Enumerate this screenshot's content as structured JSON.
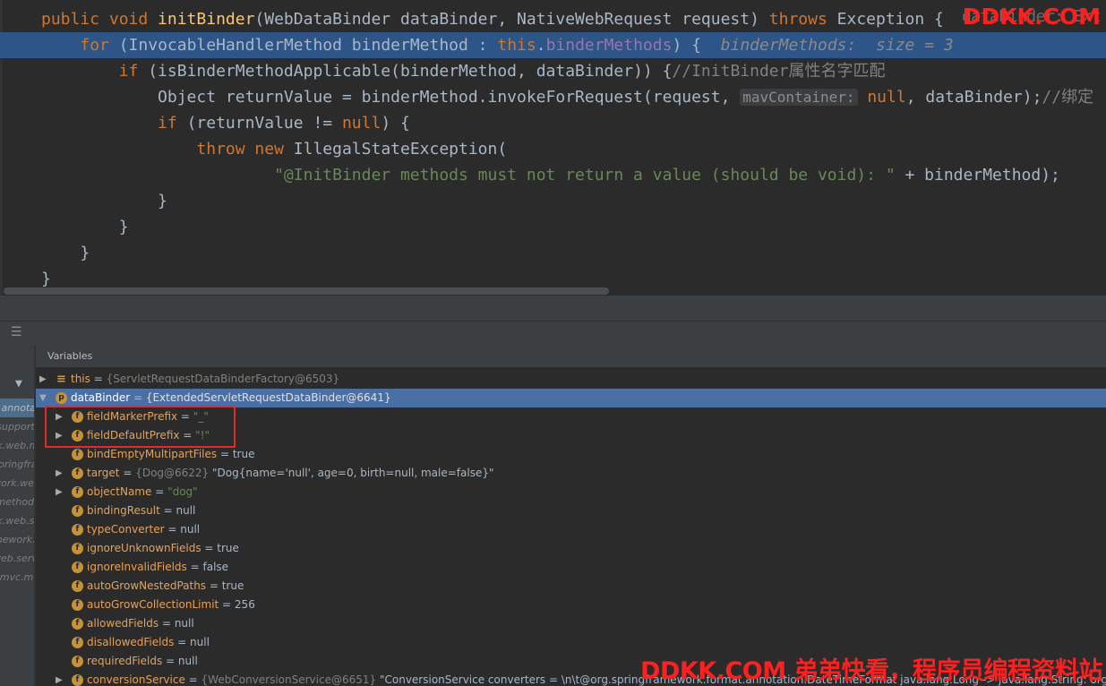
{
  "editor": {
    "lines": [
      {
        "segments": [
          {
            "t": "public ",
            "c": "kw"
          },
          {
            "t": "void ",
            "c": "kw"
          },
          {
            "t": "initBinder",
            "c": "fn"
          },
          {
            "t": "(WebDataBinder dataBinder, NativeWebRequest request) ",
            "c": "pl"
          },
          {
            "t": "throws ",
            "c": "kw"
          },
          {
            "t": "Exception { ",
            "c": "pl"
          }
        ]
      },
      {
        "segments": [
          {
            "t": "    ",
            "c": "pl"
          },
          {
            "t": "for ",
            "c": "kw"
          },
          {
            "t": "(InvocableHandlerMethod binderMethod : ",
            "c": "pl"
          },
          {
            "t": "this",
            "c": "kw"
          },
          {
            "t": ".",
            "c": "pl"
          },
          {
            "t": "binderMethods",
            "c": "fld"
          },
          {
            "t": ") {  ",
            "c": "pl"
          },
          {
            "t": "binderMethods:  size = 3",
            "c": "inl"
          }
        ]
      },
      {
        "segments": [
          {
            "t": "        ",
            "c": "pl"
          },
          {
            "t": "if ",
            "c": "kw"
          },
          {
            "t": "(isBinderMethodApplicable(binderMethod, dataBinder)) {",
            "c": "pl"
          },
          {
            "t": "//InitBinder属性名字匹配",
            "c": "cm"
          }
        ]
      },
      {
        "segments": [
          {
            "t": "            Object returnValue = binderMethod.invokeForRequest(request, ",
            "c": "pl"
          },
          {
            "t": "mavContainer:",
            "c": "hint"
          },
          {
            "t": " ",
            "c": "pl"
          },
          {
            "t": "null",
            "c": "kw"
          },
          {
            "t": ", dataBinder);",
            "c": "pl"
          },
          {
            "t": "//绑定",
            "c": "cm"
          }
        ]
      },
      {
        "segments": [
          {
            "t": "            ",
            "c": "pl"
          },
          {
            "t": "if ",
            "c": "kw"
          },
          {
            "t": "(returnValue != ",
            "c": "pl"
          },
          {
            "t": "null",
            "c": "kw"
          },
          {
            "t": ") {",
            "c": "pl"
          }
        ]
      },
      {
        "segments": [
          {
            "t": "                ",
            "c": "pl"
          },
          {
            "t": "throw ",
            "c": "kw"
          },
          {
            "t": "new ",
            "c": "kw"
          },
          {
            "t": "IllegalStateException(",
            "c": "pl"
          }
        ]
      },
      {
        "segments": [
          {
            "t": "                        ",
            "c": "pl"
          },
          {
            "t": "\"@InitBinder methods must not return a value (should be void): \"",
            "c": "str"
          },
          {
            "t": " + binderMethod);",
            "c": "pl"
          }
        ]
      },
      {
        "segments": [
          {
            "t": "            }",
            "c": "pl"
          }
        ]
      },
      {
        "segments": [
          {
            "t": "        }",
            "c": "pl"
          }
        ]
      },
      {
        "segments": [
          {
            "t": "    }",
            "c": "pl"
          }
        ]
      },
      {
        "segments": [
          {
            "t": "}",
            "c": "pl"
          }
        ]
      }
    ],
    "watermark": "DDKK.COM",
    "watermark_ghost": "dataBinder: Ext"
  },
  "debugger": {
    "layout_icon": "☰",
    "filter_icon": "▼",
    "frames": [
      {
        "label": "c.annota",
        "selected": true
      },
      {
        "label": "(support)",
        "selected": false
      },
      {
        "label": "rk.web.m",
        "selected": false
      },
      {
        "label": "springframe",
        "selected": false
      },
      {
        "label": "work.we",
        "selected": false
      },
      {
        "label": ".method",
        "selected": false
      },
      {
        "label": "rk.web.se",
        "selected": false
      },
      {
        "label": "mework.",
        "selected": false
      },
      {
        "label": "web.serv",
        "selected": false
      },
      {
        "label": "t.mvc.m",
        "selected": false
      }
    ],
    "variables_tab": "Variables",
    "variables": [
      {
        "expand": "collapsed",
        "indent": 0,
        "badge": "list",
        "badge_text": "≡",
        "name": "this",
        "sep": " = ",
        "type": "{ServletRequestDataBinderFactory@6503}",
        "value": "",
        "str": ""
      },
      {
        "expand": "expanded",
        "indent": 0,
        "badge": "p",
        "badge_text": "p",
        "name": "dataBinder",
        "sep": " = ",
        "type": "{ExtendedServletRequestDataBinder@6641}",
        "value": "",
        "str": "",
        "selected": true
      },
      {
        "expand": "collapsed",
        "indent": 1,
        "badge": "f",
        "badge_text": "f",
        "name": "fieldMarkerPrefix",
        "sep": " = ",
        "type": "",
        "value": "",
        "str": "\"_\""
      },
      {
        "expand": "collapsed",
        "indent": 1,
        "badge": "f",
        "badge_text": "f",
        "name": "fieldDefaultPrefix",
        "sep": " = ",
        "type": "",
        "value": "",
        "str": "\"!\""
      },
      {
        "expand": "none",
        "indent": 1,
        "badge": "f",
        "badge_text": "f",
        "name": "bindEmptyMultipartFiles",
        "sep": " = ",
        "type": "",
        "value": "true",
        "str": ""
      },
      {
        "expand": "collapsed",
        "indent": 1,
        "badge": "f",
        "badge_text": "f",
        "name": "target",
        "sep": " = ",
        "type": "{Dog@6622}",
        "value": " \"Dog{name='null', age=0, birth=null, male=false}\"",
        "str": ""
      },
      {
        "expand": "collapsed",
        "indent": 1,
        "badge": "f",
        "badge_text": "f",
        "name": "objectName",
        "sep": " = ",
        "type": "",
        "value": "",
        "str": "\"dog\""
      },
      {
        "expand": "none",
        "indent": 1,
        "badge": "f",
        "badge_text": "f",
        "name": "bindingResult",
        "sep": " = ",
        "type": "",
        "value": "null",
        "str": ""
      },
      {
        "expand": "none",
        "indent": 1,
        "badge": "f",
        "badge_text": "f",
        "name": "typeConverter",
        "sep": " = ",
        "type": "",
        "value": "null",
        "str": ""
      },
      {
        "expand": "none",
        "indent": 1,
        "badge": "f",
        "badge_text": "f",
        "name": "ignoreUnknownFields",
        "sep": " = ",
        "type": "",
        "value": "true",
        "str": ""
      },
      {
        "expand": "none",
        "indent": 1,
        "badge": "f",
        "badge_text": "f",
        "name": "ignoreInvalidFields",
        "sep": " = ",
        "type": "",
        "value": "false",
        "str": ""
      },
      {
        "expand": "none",
        "indent": 1,
        "badge": "f",
        "badge_text": "f",
        "name": "autoGrowNestedPaths",
        "sep": " = ",
        "type": "",
        "value": "true",
        "str": ""
      },
      {
        "expand": "none",
        "indent": 1,
        "badge": "f",
        "badge_text": "f",
        "name": "autoGrowCollectionLimit",
        "sep": " = ",
        "type": "",
        "value": "256",
        "str": ""
      },
      {
        "expand": "none",
        "indent": 1,
        "badge": "f",
        "badge_text": "f",
        "name": "allowedFields",
        "sep": " = ",
        "type": "",
        "value": "null",
        "str": ""
      },
      {
        "expand": "none",
        "indent": 1,
        "badge": "f",
        "badge_text": "f",
        "name": "disallowedFields",
        "sep": " = ",
        "type": "",
        "value": "null",
        "str": ""
      },
      {
        "expand": "none",
        "indent": 1,
        "badge": "f",
        "badge_text": "f",
        "name": "requiredFields",
        "sep": " = ",
        "type": "",
        "value": "null",
        "str": ""
      },
      {
        "expand": "collapsed",
        "indent": 1,
        "badge": "f",
        "badge_text": "f",
        "name": "conversionService",
        "sep": " = ",
        "type": "{WebConversionService@6651}",
        "value": " \"ConversionService converters = \\n\\t@org.springframework.format.annotation.DateTimeFormat java.lang.Long -> java.lang.String: org.spr",
        "str": ""
      }
    ],
    "watermark": "DDKK.COM 弟弟快看，程序员编程资料站"
  }
}
